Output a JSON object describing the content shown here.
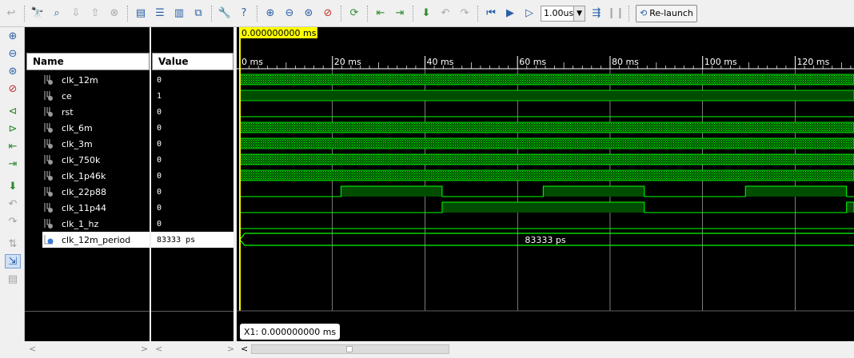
{
  "toolbar": {
    "zoom_value": "1.00us",
    "relaunch_label": "Re-launch"
  },
  "columns": {
    "name_header": "Name",
    "value_header": "Value"
  },
  "signals": [
    {
      "name": "clk_12m",
      "value": "0",
      "type": "bit"
    },
    {
      "name": "ce",
      "value": "1",
      "type": "bit"
    },
    {
      "name": "rst",
      "value": "0",
      "type": "bit"
    },
    {
      "name": "clk_6m",
      "value": "0",
      "type": "bit"
    },
    {
      "name": "clk_3m",
      "value": "0",
      "type": "bit"
    },
    {
      "name": "clk_750k",
      "value": "0",
      "type": "bit"
    },
    {
      "name": "clk_1p46k",
      "value": "0",
      "type": "bit"
    },
    {
      "name": "clk_22p88",
      "value": "0",
      "type": "bit"
    },
    {
      "name": "clk_11p44",
      "value": "0",
      "type": "bit"
    },
    {
      "name": "clk_1_hz",
      "value": "0",
      "type": "bit"
    },
    {
      "name": "clk_12m_period",
      "value": "83333 ps",
      "type": "constant"
    }
  ],
  "waveform": {
    "cursor_time": "0.000000000 ms",
    "x1_label": "X1: 0.000000000 ms",
    "time_ticks": [
      "0 ms",
      "20 ms",
      "40 ms",
      "60 ms",
      "80 ms",
      "100 ms",
      "120 ms"
    ],
    "time_range_ms": [
      0,
      133.4
    ],
    "period_label": "83333 ps",
    "clk_22p88_high_ms": [
      [
        21.85,
        43.7
      ],
      [
        65.55,
        87.4
      ],
      [
        109.25,
        131.1
      ]
    ],
    "clk_11p44_high_ms": [
      [
        43.7,
        87.4
      ],
      [
        131.1,
        174.8
      ]
    ],
    "colors": {
      "signal": "#00ff00",
      "signal_fill": "#004d00",
      "grid": "#d0d0d0",
      "cursor": "#ffff00",
      "background": "#000000"
    }
  }
}
